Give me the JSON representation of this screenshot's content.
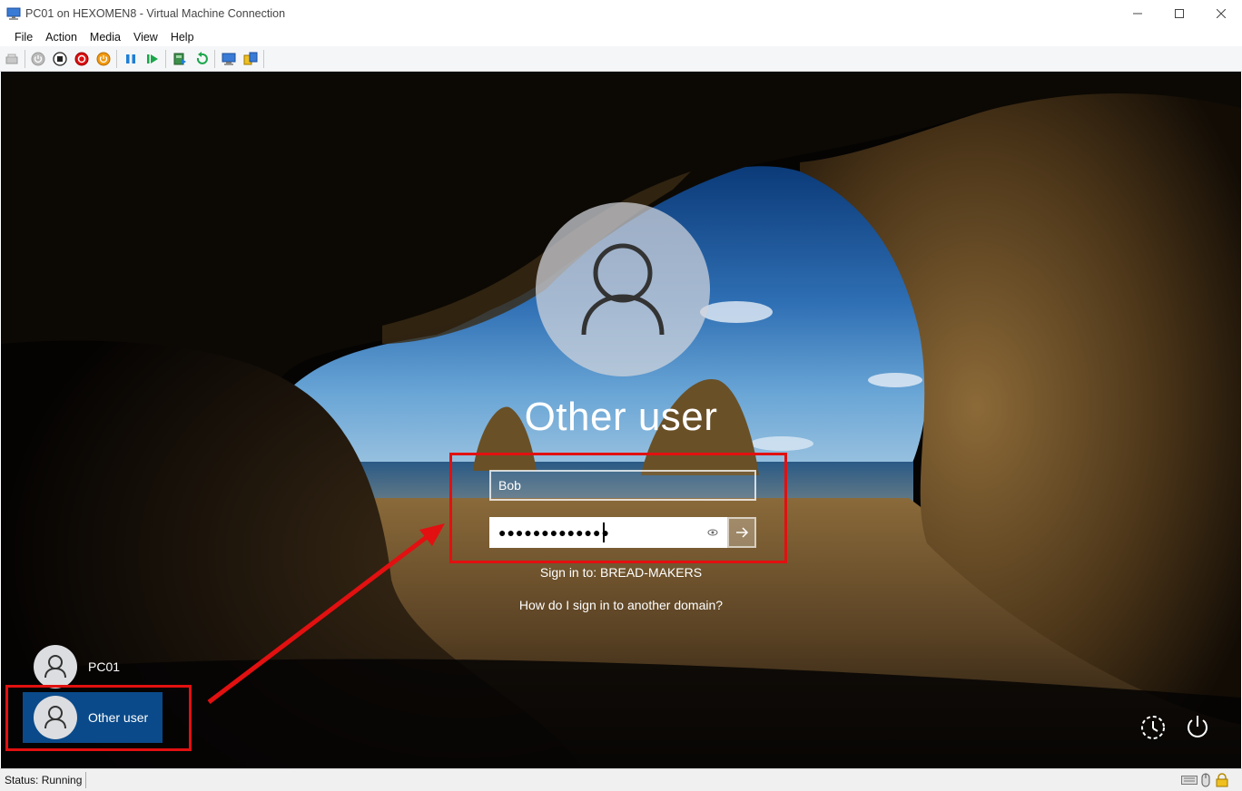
{
  "window": {
    "title": "PC01 on HEXOMEN8 - Virtual Machine Connection",
    "minimize_icon": "minimize-icon",
    "maximize_icon": "maximize-icon",
    "close_icon": "close-icon"
  },
  "menu": {
    "items": [
      "File",
      "Action",
      "Media",
      "View",
      "Help"
    ]
  },
  "toolbar": {
    "icons": [
      "ctrl-alt-del-icon",
      "start-icon",
      "turn-off-icon",
      "shutdown-icon",
      "save-icon",
      "pause-icon",
      "resume-icon",
      "checkpoint-icon",
      "revert-icon",
      "enhanced-session-icon",
      "share-icon"
    ]
  },
  "login": {
    "display_name": "Other user",
    "username_value": "Bob",
    "password_value": "●●●●●●●●●●●●●",
    "sign_in_to": "Sign in to: BREAD-MAKERS",
    "domain_help_link": "How do I sign in to another domain?"
  },
  "users": [
    {
      "name": "PC01",
      "selected": false
    },
    {
      "name": "Other user",
      "selected": true
    }
  ],
  "status": {
    "text": "Status: Running"
  },
  "colors": {
    "annotation": "#e21010",
    "selected_user": "#0a4a8a"
  }
}
